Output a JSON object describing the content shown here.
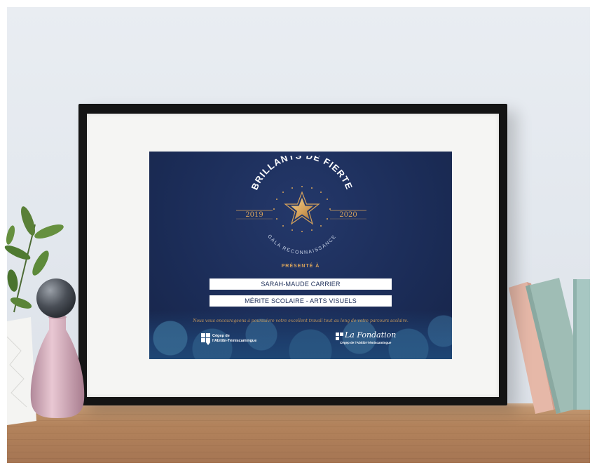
{
  "certificate": {
    "arc_title": "BRILLANTS DE FIERTE",
    "year_left": "2019",
    "year_right": "2020",
    "arc_subtitle": "GALA RECONNAISSANCE",
    "presented_label": "PRÉSENTÉ À",
    "recipient_name": "SARAH-MAUDE CARRIER",
    "award": "MÉRITE SCOLAIRE - ARTS VISUELS",
    "motto": "Nous vous encourageons à poursuivre votre excellent travail tout au long de votre parcours scolaire.",
    "logo_left_text": "Cégep de\nl'Abitibi-Témiscamingue",
    "logo_right_title": "La Fondation",
    "logo_right_sub": "Cégep de l'Abitibi-Témiscamingue"
  },
  "colors": {
    "navy": "#1b2c57",
    "gold": "#d6a25b",
    "frame": "#141414",
    "mat": "#f5f5f3",
    "shelf_wood": "#b3835c",
    "wall": "#e3e8ee",
    "book_pink": "#e6b8a8",
    "book_mint": "#9fbdb5"
  },
  "icons": [
    "gold-star-icon",
    "cegep-logo-icon",
    "fondation-logo-icon"
  ]
}
